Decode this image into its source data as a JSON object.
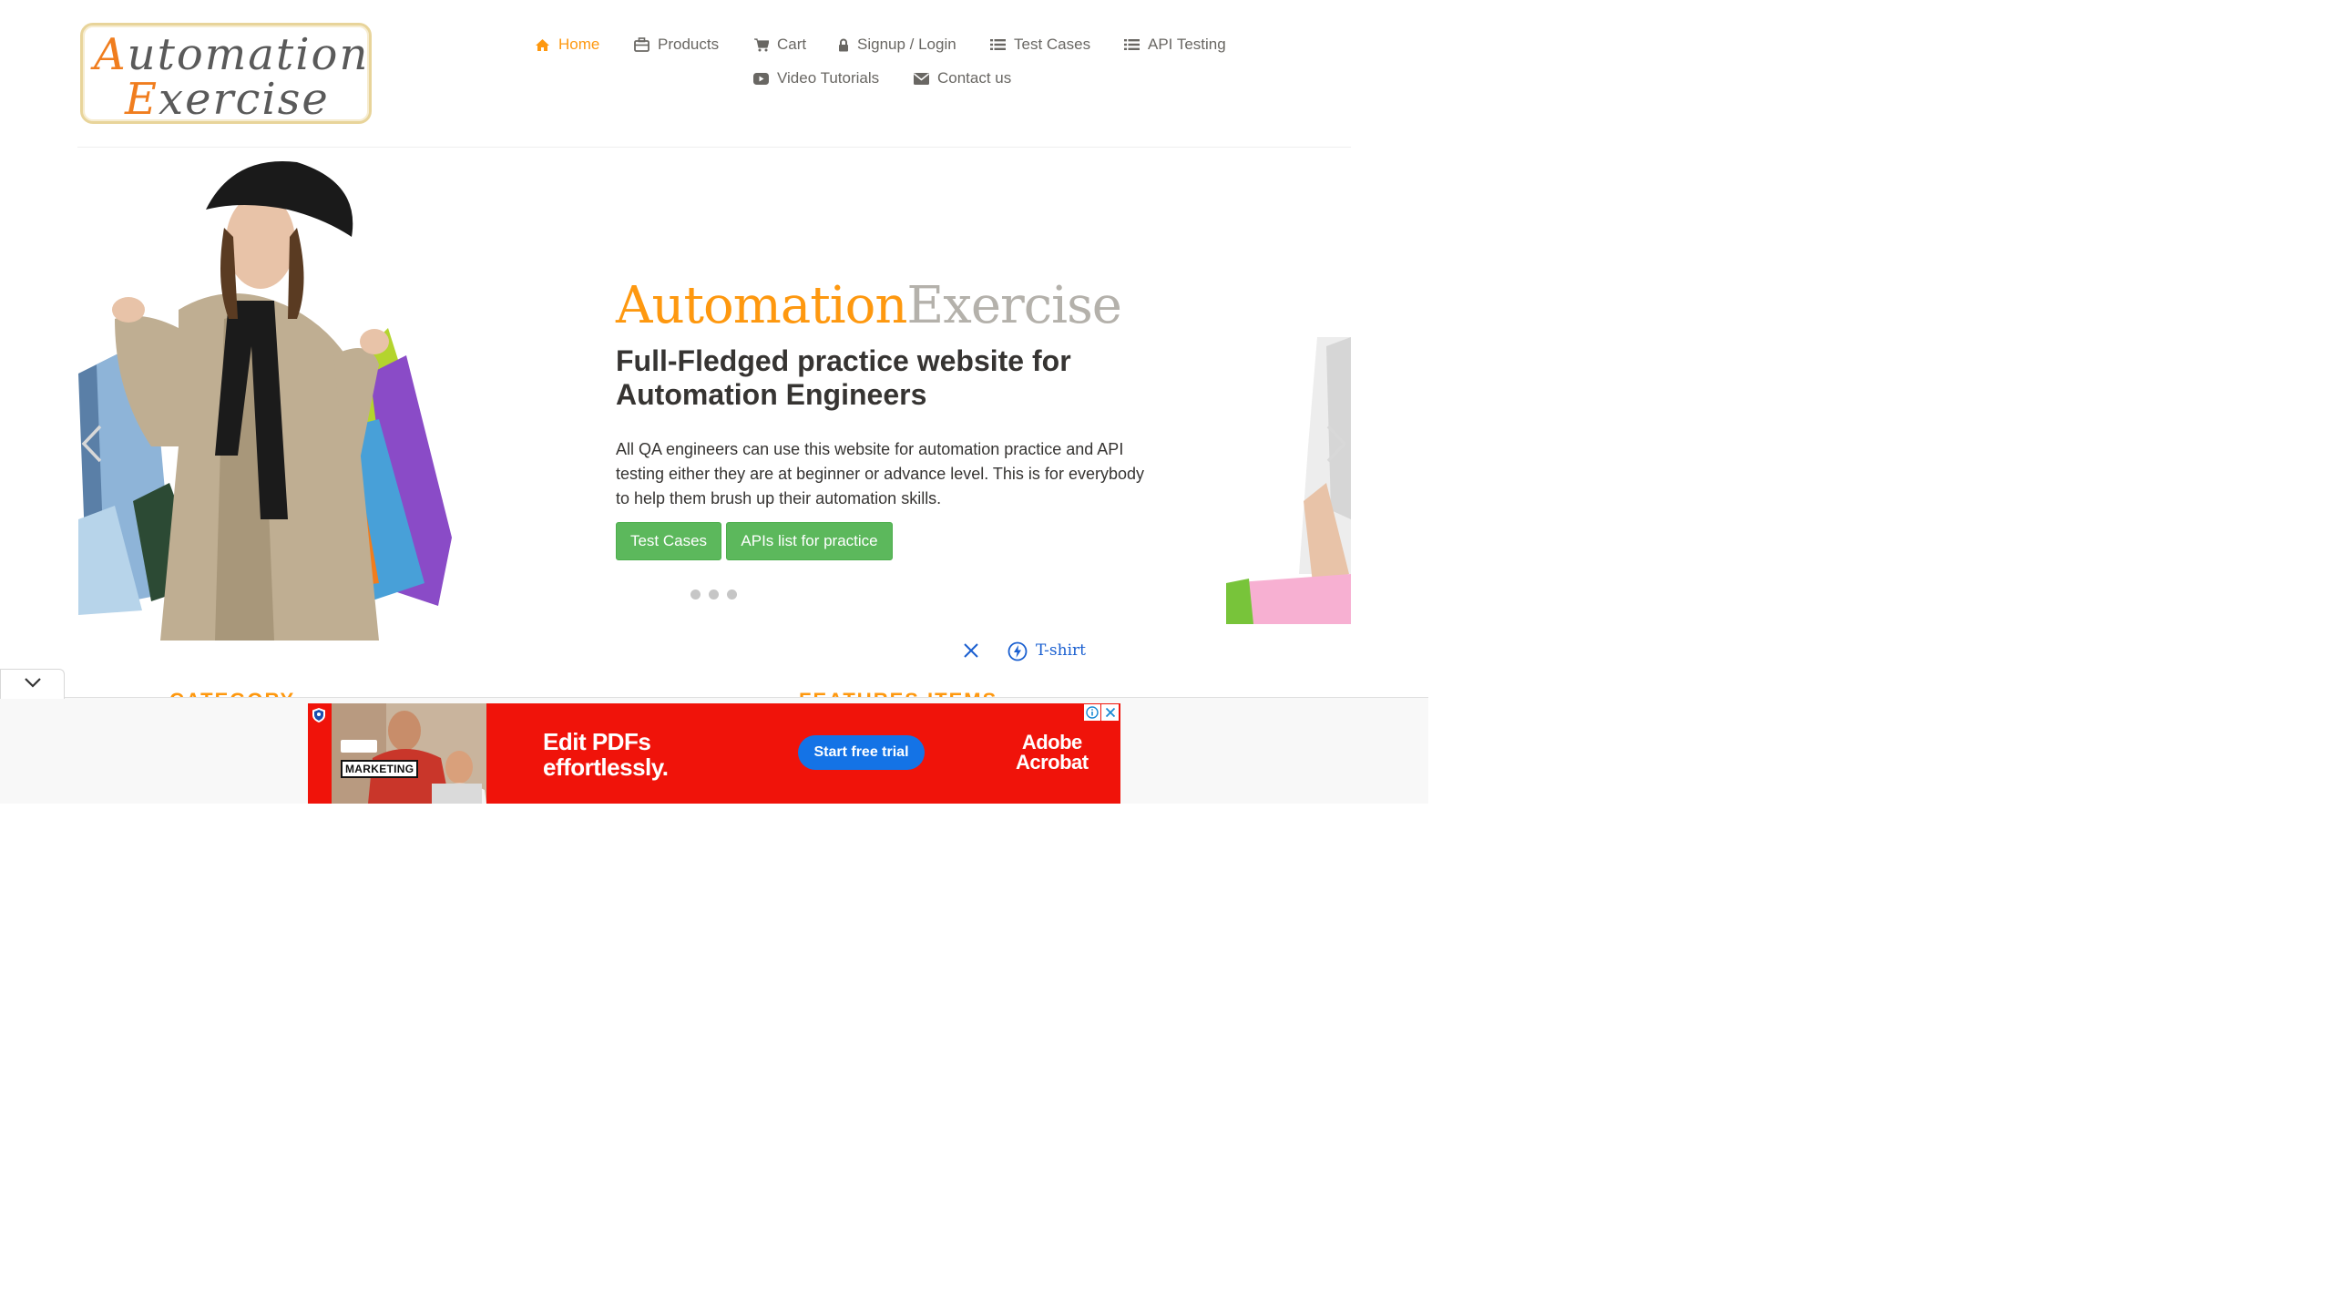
{
  "logo": {
    "line1_cap": "A",
    "line1_rest": "utomation",
    "line2_cap": "E",
    "line2_rest": "xercise"
  },
  "nav": {
    "home": "Home",
    "products": "Products",
    "cart": "Cart",
    "signup_login": "Signup / Login",
    "test_cases": "Test Cases",
    "api_testing": "API Testing",
    "video_tutorials": "Video Tutorials",
    "contact_us": "Contact us"
  },
  "slider": {
    "brand_part1": "Automation",
    "brand_part2": "Exercise",
    "title": "Full-Fledged practice website for Automation Engineers",
    "description": "All QA engineers can use this website for automation practice and API testing either they are at beginner or advance level. This is for everybody to help them brush up their automation skills.",
    "button_test_cases": "Test Cases",
    "button_apis": "APIs list for practice",
    "dot_count": 3
  },
  "search_chip": {
    "label": "T-shirt"
  },
  "sections": {
    "category": "CATEGORY",
    "features": "FEATURES ITEMS"
  },
  "ad": {
    "tag": "MARKETING",
    "headline_line1": "Edit PDFs",
    "headline_line2": "effortlessly.",
    "cta": "Start free trial",
    "brand_line1": "Adobe",
    "brand_line2": "Acrobat"
  },
  "colors": {
    "accent": "#FE980F",
    "nav_text": "#696763",
    "button_green": "#5cb85c",
    "ad_red": "#f0130a",
    "ad_cta_blue": "#1473e6"
  },
  "icons": {
    "home": "home-icon",
    "products": "briefcase-icon",
    "cart": "shopping-cart-icon",
    "login": "lock-icon",
    "test_cases": "list-icon",
    "api": "list-icon",
    "video": "youtube-play-icon",
    "contact": "envelope-icon"
  }
}
